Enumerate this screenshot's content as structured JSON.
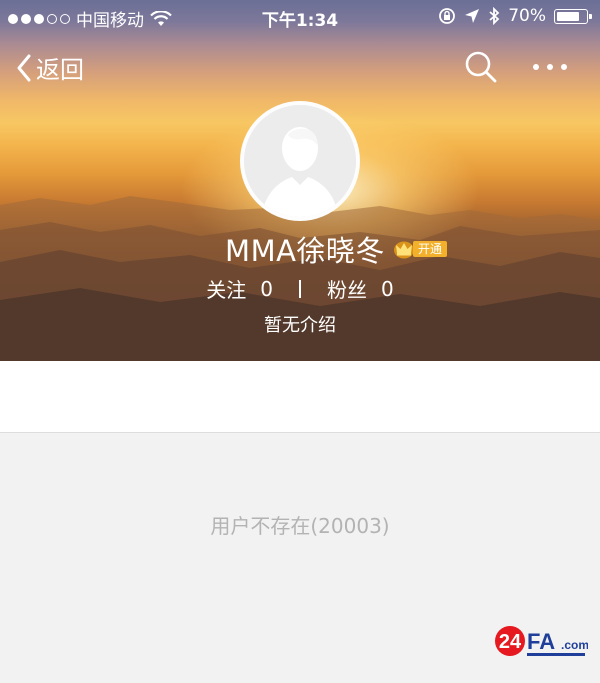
{
  "status_bar": {
    "carrier": "中国移动",
    "time": "下午1:34",
    "battery_percent": "70%",
    "battery_level": 0.7
  },
  "nav": {
    "back_label": "返回"
  },
  "profile": {
    "username": "MMA徐晓冬",
    "vip_label": "开通",
    "following_label": "关注",
    "following_count": "0",
    "followers_label": "粉丝",
    "followers_count": "0",
    "bio": "暂无介绍"
  },
  "content": {
    "error_message": "用户不存在(20003)"
  },
  "watermark": {
    "text_num": "24",
    "text_fa": "FA",
    "text_com": ".com"
  },
  "colors": {
    "vip_gold": "#f2b02b",
    "error_text": "#b3b3b3",
    "page_bg": "#f2f2f2"
  }
}
